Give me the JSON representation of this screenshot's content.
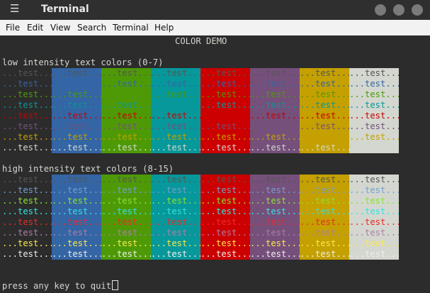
{
  "window": {
    "title": "Terminal"
  },
  "menu": [
    "File",
    "Edit",
    "View",
    "Search",
    "Terminal",
    "Help"
  ],
  "terminal": {
    "header": "COLOR DEMO",
    "low_title": "low intensity text colors (0-7)",
    "high_title": "high intensity text colors (8-15)",
    "prompt": "press any key to quit",
    "cell_text": "...test...",
    "bg_colors": [
      "#2c2c2c",
      "#3465a4",
      "#4e9a06",
      "#06989a",
      "#cc0000",
      "#75507b",
      "#c4a000",
      "#d3d7cf"
    ],
    "low_fg": [
      "#555753",
      "#3465a4",
      "#4e9a06",
      "#06989a",
      "#cc0000",
      "#75507b",
      "#c4a000",
      "#d3d7cf"
    ],
    "high_fg": [
      "#555753",
      "#729fcf",
      "#8ae234",
      "#34e2e2",
      "#ef2929",
      "#ad7fa8",
      "#fce94f",
      "#eeeeec"
    ]
  },
  "colors": {
    "titlebar": "#2f2f2f",
    "terminal_bg": "#2c2c2c",
    "menubar": "#f2f2f2"
  }
}
